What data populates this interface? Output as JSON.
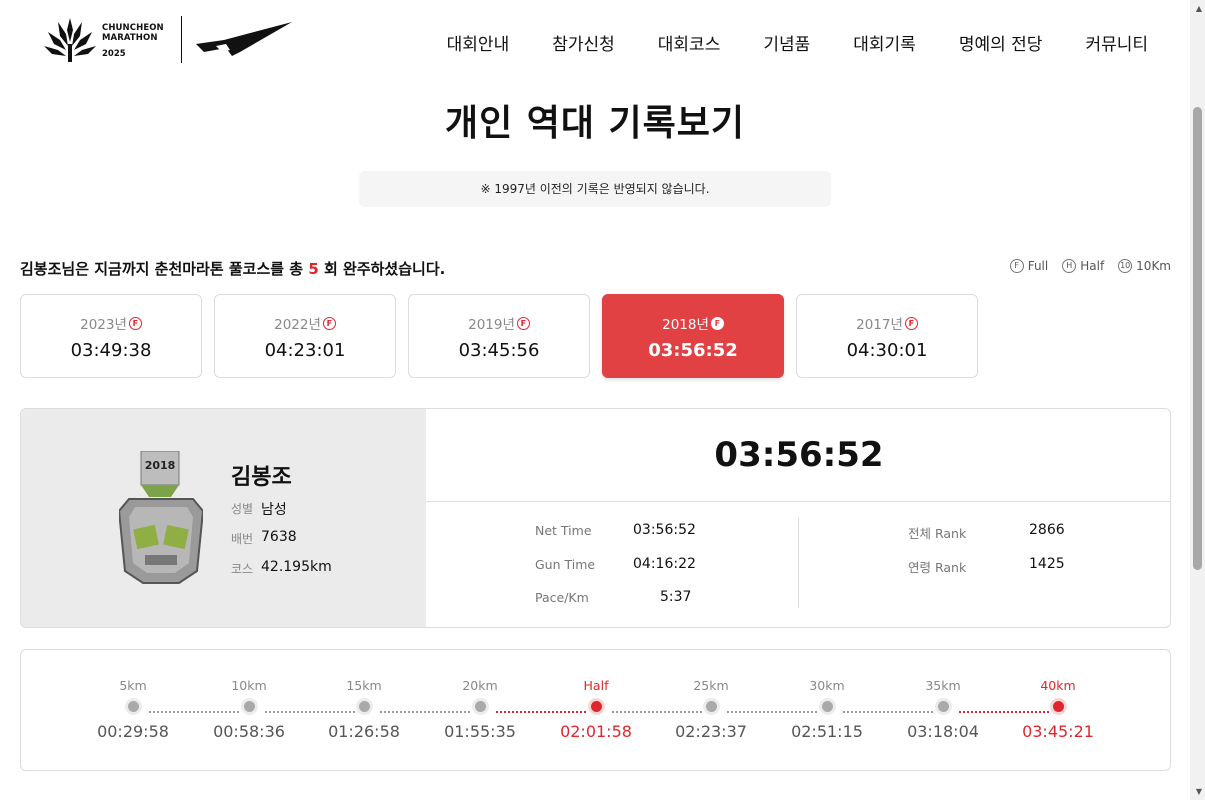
{
  "header": {
    "logo_line1": "CHUNCHEON",
    "logo_line2": "MARATHON",
    "logo_year": "2025",
    "nav": [
      "대회안내",
      "참가신청",
      "대회코스",
      "기념품",
      "대회기록",
      "명예의 전당",
      "커뮤니티"
    ]
  },
  "page_title": "개인 역대 기록보기",
  "notice": "※ 1997년 이전의 기록은 반영되지 않습니다.",
  "summary": {
    "prefix": "김봉조님은 지금까지 춘천마라톤 풀코스를 총",
    "count": "5",
    "suffix": "회 완주하셨습니다."
  },
  "legend": [
    {
      "badge": "F",
      "label": "Full"
    },
    {
      "badge": "H",
      "label": "Half"
    },
    {
      "badge": "10",
      "label": "10Km"
    }
  ],
  "years": [
    {
      "year": "2023년",
      "badge": "F",
      "time": "03:49:38",
      "active": false
    },
    {
      "year": "2022년",
      "badge": "F",
      "time": "04:23:01",
      "active": false
    },
    {
      "year": "2019년",
      "badge": "F",
      "time": "03:45:56",
      "active": false
    },
    {
      "year": "2018년",
      "badge": "F",
      "time": "03:56:52",
      "active": true
    },
    {
      "year": "2017년",
      "badge": "F",
      "time": "04:30:01",
      "active": false
    }
  ],
  "detail": {
    "medal_year": "2018",
    "name": "김봉조",
    "gender_label": "성별",
    "gender": "남성",
    "bib_label": "배번",
    "bib": "7638",
    "course_label": "코스",
    "course": "42.195km",
    "record": "03:56:52",
    "net_time_label": "Net Time",
    "net_time": "03:56:52",
    "gun_time_label": "Gun Time",
    "gun_time": "04:16:22",
    "pace_label": "Pace/Km",
    "pace": "5:37",
    "overall_rank_label": "전체 Rank",
    "overall_rank": "2866",
    "age_rank_label": "연령 Rank",
    "age_rank": "1425"
  },
  "splits": [
    {
      "label": "5km",
      "time": "00:29:58",
      "highlight": false
    },
    {
      "label": "10km",
      "time": "00:58:36",
      "highlight": false
    },
    {
      "label": "15km",
      "time": "01:26:58",
      "highlight": false
    },
    {
      "label": "20km",
      "time": "01:55:35",
      "highlight": false
    },
    {
      "label": "Half",
      "time": "02:01:58",
      "highlight": true
    },
    {
      "label": "25km",
      "time": "02:23:37",
      "highlight": false
    },
    {
      "label": "30km",
      "time": "02:51:15",
      "highlight": false
    },
    {
      "label": "35km",
      "time": "03:18:04",
      "highlight": false
    },
    {
      "label": "40km",
      "time": "03:45:21",
      "highlight": true
    }
  ],
  "colors": {
    "accent": "#e24144",
    "highlight_text": "#e0262c",
    "panel_bg": "#ebebeb"
  }
}
